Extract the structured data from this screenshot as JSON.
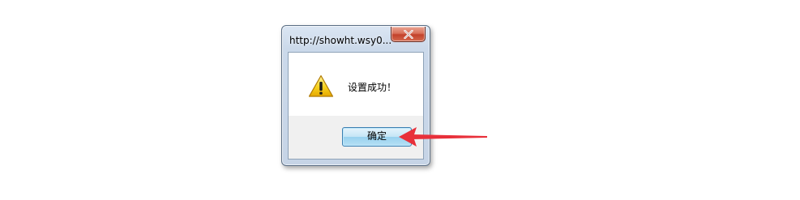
{
  "dialog": {
    "title": "http://showht.wsy0...",
    "message": "设置成功！",
    "ok_label": "确定",
    "icon": "warning-icon",
    "close_icon": "close-icon"
  },
  "annotation": {
    "type": "arrow",
    "color": "#e8303a",
    "points_to": "ok-button"
  },
  "colors": {
    "window_frame": "#c6d4e6",
    "close_button": "#c2412a",
    "ok_button_border": "#3c7fb1",
    "warning_yellow": "#f5c400"
  }
}
